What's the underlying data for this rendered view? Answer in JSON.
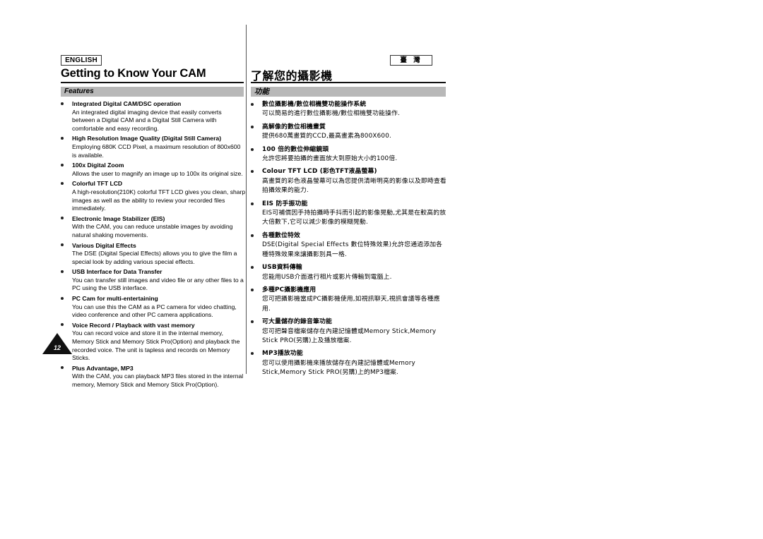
{
  "header": {
    "english_badge": "ENGLISH",
    "taiwan_badge": "臺 灣",
    "title_en": "Getting to Know Your CAM",
    "title_zh": "了解您的攝影機"
  },
  "section": {
    "label_en": "Features",
    "label_zh": "功能"
  },
  "page_number": "12",
  "features_en": [
    {
      "title": "Integrated Digital CAM/DSC operation",
      "body": "An integrated digital imaging device that easily converts between a Digital CAM and a Digital Still Camera with comfortable and easy recording."
    },
    {
      "title": "High Resolution Image Quality (Digital Still Camera)",
      "body": "Employing 680K CCD Pixel, a maximum resolution of 800x600 is available."
    },
    {
      "title": "100x Digital Zoom",
      "body": "Allows the user to magnify an image up to 100x its original size."
    },
    {
      "title": "Colorful TFT LCD",
      "body": "A high-resolution(210K) colorful TFT LCD gives you clean, sharp images as well as the ability to review your recorded files immediately."
    },
    {
      "title": "Electronic Image Stabilizer (EIS)",
      "body": "With the CAM, you can reduce unstable images by avoiding natural shaking movements."
    },
    {
      "title": "Various Digital Effects",
      "body": "The DSE (Digital Special Effects) allows you to give the film a special look by adding various special effects."
    },
    {
      "title": "USB Interface for Data Transfer",
      "body": "You can transfer still images and video file or any other files to a PC using the USB interface."
    },
    {
      "title": "PC Cam for multi-entertaining",
      "body": "You can use this the CAM as a PC camera for video chatting, video conference and other PC camera applications."
    },
    {
      "title": "Voice Record / Playback with vast memory",
      "body": "You can record voice and store it in the internal memory, Memory Stick and Memory Stick Pro(Option) and playback the recorded voice. The unit is tapless and records on Memory Sticks."
    },
    {
      "title": "Plus Advantage, MP3",
      "body": "With the CAM, you can playback MP3 files stored in the internal memory, Memory Stick and Memory Stick Pro(Option)."
    }
  ],
  "features_zh": [
    {
      "title": "數位攝影機/數位相機雙功能操作系統",
      "body": "可以簡易的進行數位攝影機/數位相機雙功能操作."
    },
    {
      "title": "高解像的數位相機畫質",
      "body": "提供680萬畫質的CCD,最高畫素為800X600."
    },
    {
      "title": "100 倍的數位伸縮鏡頭",
      "body": "允許您將要拍攝的畫面放大到原始大小的100倍."
    },
    {
      "title": "Colour TFT LCD (彩色TFT液晶螢幕)",
      "body": "高畫質的彩色液晶螢幕可以為您提供清晰明亮的影像以及即時查看拍攝效果的能力."
    },
    {
      "title": "EIS 防手振功能",
      "body": "EIS可補償因手持拍攝時手抖而引起的影像晃動,尤其是在較高的放大倍數下,它可以減少影像的模糊晃動."
    },
    {
      "title": "各種數位特效",
      "body": "DSE(Digital Special Effects 數位特殊效果)允許您通過添加各種特殊效果來讓攝影別具一格."
    },
    {
      "title": "USB資料傳輸",
      "body": "您能用USB介面進行相片或影片傳輸到電腦上."
    },
    {
      "title": "多種PC攝影機應用",
      "body": "您可把攝影機當成PC攝影機使用,如視訊聊天,視訊會議等各種應用."
    },
    {
      "title": "可大量儲存的錄音筆功能",
      "body": "您可把聲音檔案儲存在內建記憶體或Memory Stick,Memory Stick PRO(另購)上及播放檔案."
    },
    {
      "title": "MP3播放功能",
      "body": "您可以使用攝影機來播放儲存在內建記憶體或Memory Stick,Memory Stick PRO(另購)上的MP3檔案."
    }
  ]
}
